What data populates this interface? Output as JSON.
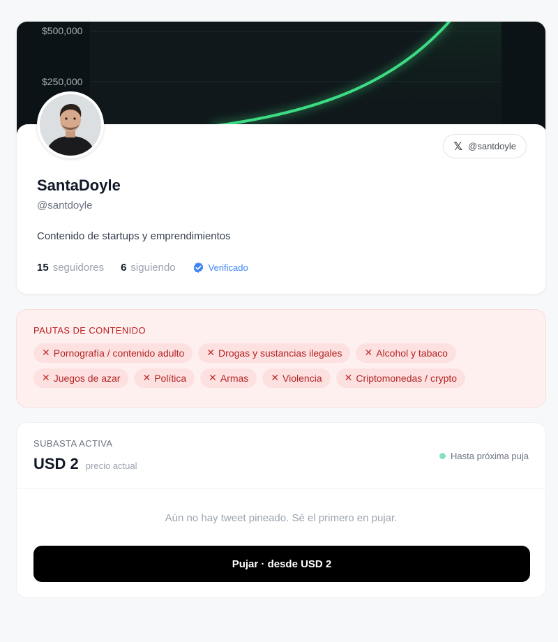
{
  "banner": {
    "y_labels": [
      "$500,000",
      "$250,000"
    ],
    "line_color": "#3ddc84",
    "background": "#0c1316"
  },
  "profile": {
    "x_handle": "@santdoyle",
    "x_icon": "x-logo",
    "name": "SantaDoyle",
    "handle": "@santdoyle",
    "bio": "Contenido de startups y emprendimientos",
    "followers_count": "15",
    "followers_label": "seguidores",
    "following_count": "6",
    "following_label": "siguiendo",
    "verified_label": "Verificado",
    "verified_color": "#3b82f6"
  },
  "guidelines": {
    "title": "PAUTAS DE CONTENIDO",
    "chips": [
      "Pornografía / contenido adulto",
      "Drogas y sustancias ilegales",
      "Alcohol y tabaco",
      "Juegos de azar",
      "Política",
      "Armas",
      "Violencia",
      "Criptomonedas / crypto"
    ],
    "accent": "#b42323"
  },
  "auction": {
    "title": "SUBASTA ACTIVA",
    "amount": "USD 2",
    "amount_label": "precio actual",
    "status": "Hasta próxima puja",
    "empty_text": "Aún no hay tweet pineado. Sé el primero en pujar.",
    "button_label": "Pujar · desde USD 2"
  }
}
